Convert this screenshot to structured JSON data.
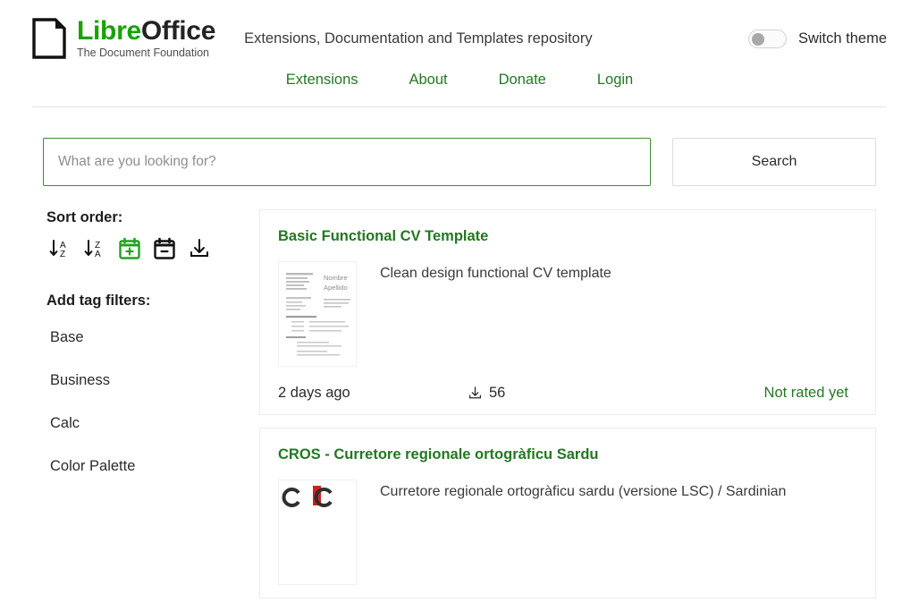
{
  "header": {
    "logo": {
      "icon": "document-icon",
      "name_part1": "Libre",
      "name_part2": "Office",
      "subtitle": "The Document Foundation"
    },
    "tagline": "Extensions, Documentation and Templates repository",
    "theme_toggle": {
      "label": "Switch theme",
      "state": "off"
    },
    "nav": [
      {
        "label": "Extensions",
        "name": "extensions"
      },
      {
        "label": "About",
        "name": "about"
      },
      {
        "label": "Donate",
        "name": "donate"
      },
      {
        "label": "Login",
        "name": "login"
      }
    ]
  },
  "search": {
    "placeholder": "What are you looking for?",
    "value": "",
    "button_label": "Search"
  },
  "sidebar": {
    "sort_heading": "Sort order:",
    "sort_icons": [
      {
        "name": "sort-alpha-asc-icon",
        "label": "A–Z",
        "active": false
      },
      {
        "name": "sort-alpha-desc-icon",
        "label": "Z–A",
        "active": false
      },
      {
        "name": "calendar-plus-icon",
        "label": "Newest",
        "active": true
      },
      {
        "name": "calendar-minus-icon",
        "label": "Oldest",
        "active": false
      },
      {
        "name": "download-icon",
        "label": "Downloads",
        "active": false
      }
    ],
    "tag_heading": "Add tag filters:",
    "tags": [
      {
        "label": "Base"
      },
      {
        "label": "Business"
      },
      {
        "label": "Calc"
      },
      {
        "label": "Color Palette"
      }
    ]
  },
  "results": [
    {
      "title": "Basic Functional CV Template",
      "description": "Clean design functional CV template",
      "date": "2 days ago",
      "downloads": "56",
      "rating": "Not rated yet",
      "thumbnail": "cv-document-thumbnail",
      "thumb_name": "Nombre",
      "thumb_surname": "Apellido"
    },
    {
      "title": "CROS - Curretore regionale ortogràficu Sardu",
      "description": "Curretore regionale ortogràficu sardu (versione LSC) / Sardinian",
      "thumbnail": "cros-logo-thumbnail"
    }
  ],
  "colors": {
    "brand_green": "#18a303",
    "link_green": "#227821",
    "text_dark": "#2b2b2b",
    "border_light": "#ececec"
  }
}
